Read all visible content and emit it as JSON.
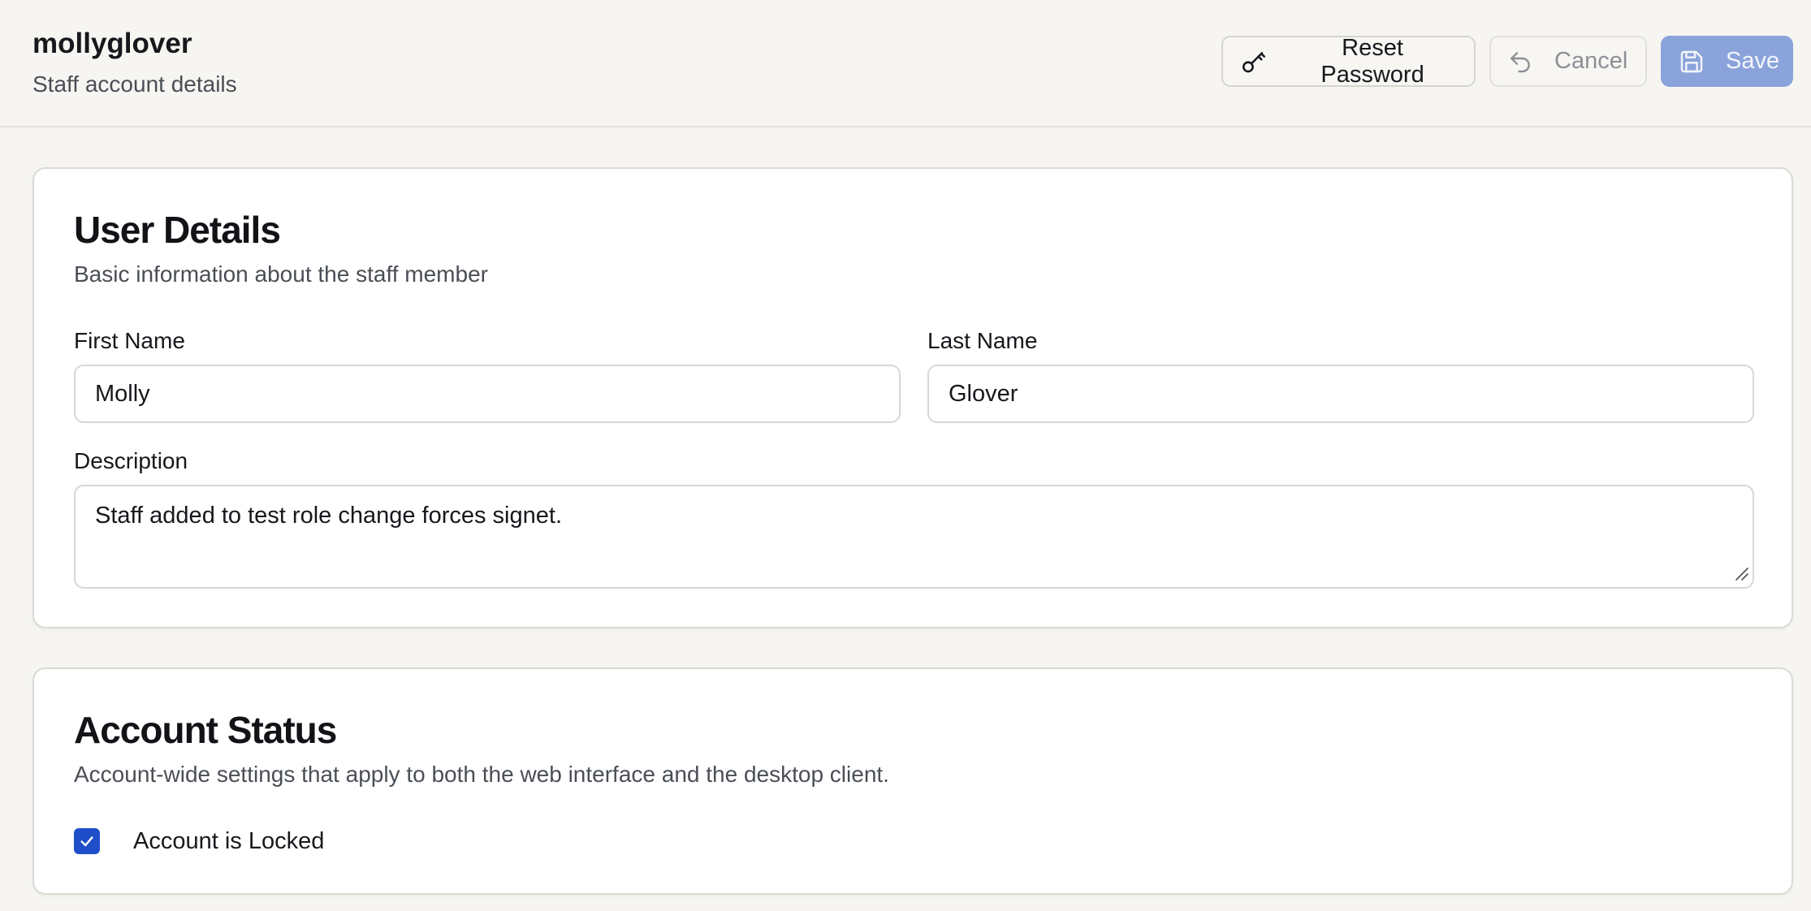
{
  "header": {
    "title": "mollyglover",
    "subtitle": "Staff account details",
    "reset_label": "Reset Password",
    "cancel_label": "Cancel",
    "save_label": "Save"
  },
  "details": {
    "heading": "User Details",
    "description": "Basic information about the staff member",
    "first_name_label": "First Name",
    "first_name_value": "Molly",
    "last_name_label": "Last Name",
    "last_name_value": "Glover",
    "description_label": "Description",
    "description_value": "Staff added to test role change forces signet."
  },
  "status": {
    "heading": "Account Status",
    "description": "Account-wide settings that apply to both the web interface and the desktop client.",
    "locked_label": "Account is Locked",
    "locked_checked": true
  },
  "icons": {
    "reset": "key-icon",
    "cancel": "undo-icon",
    "save": "floppy-disk-icon",
    "check": "checkmark-icon"
  },
  "colors": {
    "accent": "#1f4fc8",
    "save_disabled": "#8aa3db",
    "background": "#f6f5f1"
  }
}
